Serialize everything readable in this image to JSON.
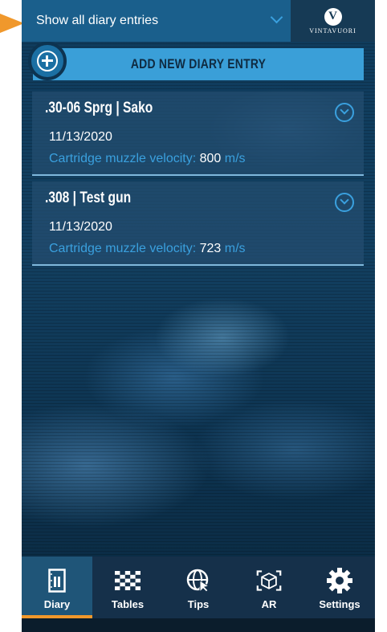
{
  "filter": {
    "label": "Show all diary entries"
  },
  "brand": {
    "logo_letter": "V",
    "name": "VintaVuori"
  },
  "add_entry": {
    "label": "ADD NEW DIARY ENTRY"
  },
  "entries": [
    {
      "title": ".30-06 Sprg | Sako",
      "date": "11/13/2020",
      "velocity_label": "Cartridge muzzle velocity:",
      "velocity_value": "800",
      "velocity_unit": "m/s"
    },
    {
      "title": ".308 | Test gun",
      "date": "11/13/2020",
      "velocity_label": "Cartridge muzzle velocity:",
      "velocity_value": "723",
      "velocity_unit": "m/s"
    }
  ],
  "nav": {
    "items": [
      {
        "label": "Diary",
        "icon": "diary-icon",
        "active": true
      },
      {
        "label": "Tables",
        "icon": "tables-icon"
      },
      {
        "label": "Tips",
        "icon": "tips-icon"
      },
      {
        "label": "AR",
        "icon": "ar-icon"
      },
      {
        "label": "Settings",
        "icon": "settings-icon"
      }
    ]
  },
  "colors": {
    "accent": "#3aa0de",
    "active_tab": "#f0982c",
    "header": "#1a5f8c"
  }
}
